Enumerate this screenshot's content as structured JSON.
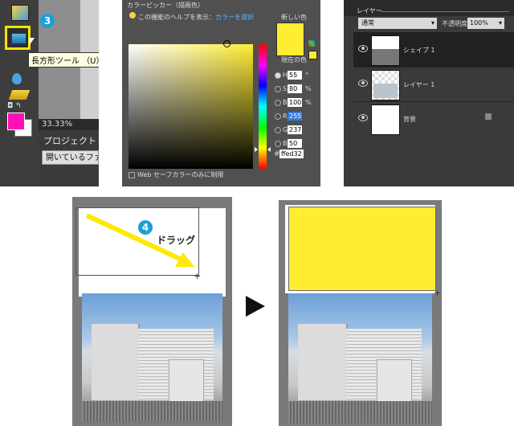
{
  "toolbox": {
    "step_number": "3",
    "tooltip": "長方形ツール （U）",
    "zoom": "33.33%",
    "project_label": "プロジェクトエリア",
    "open_files_button": "開いているファイ",
    "foreground_color": "#ff10b4",
    "background_color": "#ffffff"
  },
  "picker": {
    "title": "カラーピッカー（描画色）",
    "help_prefix": "この機能のヘルプを表示：",
    "help_link": "カラーを選択",
    "new_label": "新しい色",
    "current_label": "現在の色",
    "new_color": "#ffed32",
    "fields": [
      {
        "label": "H:",
        "value": "55",
        "unit": "°",
        "checked": true
      },
      {
        "label": "S:",
        "value": "80",
        "unit": "%"
      },
      {
        "label": "B:",
        "value": "100",
        "unit": "%"
      },
      {
        "label": "R:",
        "value": "255",
        "unit": ""
      },
      {
        "label": "G:",
        "value": "237",
        "unit": ""
      },
      {
        "label": "B:",
        "value": "50",
        "unit": ""
      }
    ],
    "hex_label": "#",
    "hex_value": "ffed32",
    "web_safe": "Web セーフカラーのみに制限"
  },
  "layers": {
    "title": "レイヤー",
    "blend_mode": "通常",
    "opacity_label": "不透明度:",
    "opacity_value": "100%",
    "items": [
      {
        "name": "シェイプ 1",
        "selected": true
      },
      {
        "name": "レイヤー 1"
      },
      {
        "name": "背景",
        "locked": true
      }
    ]
  },
  "annotation": {
    "step_number": "4",
    "drag_label": "ドラッグ",
    "shape_color": "#ffed32"
  }
}
